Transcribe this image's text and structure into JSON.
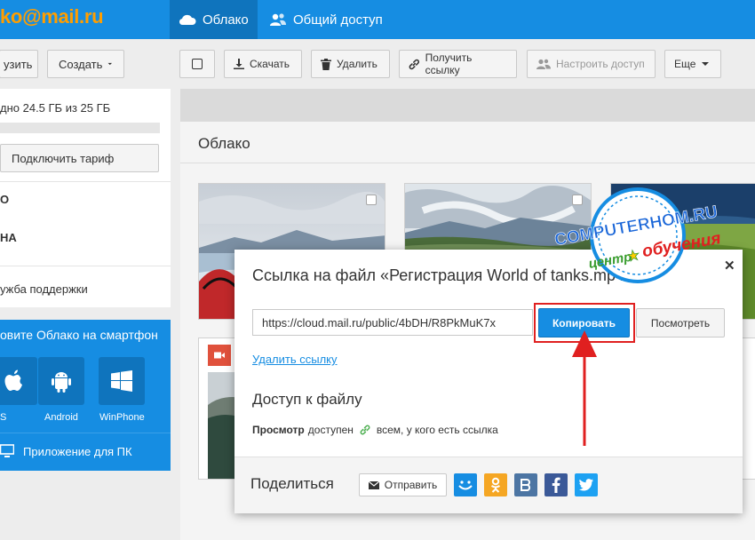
{
  "header": {
    "logo": "ko@mail.ru",
    "tabs": [
      {
        "label": "Облако",
        "icon": "cloud-icon",
        "active": true
      },
      {
        "label": "Общий доступ",
        "icon": "users-icon",
        "active": false
      }
    ]
  },
  "sidebar": {
    "upload_label": "узить",
    "create_label": "Создать",
    "storage_text": "дно 24.5 ГБ из 25 ГБ",
    "tariff_label": "Подключить тариф",
    "items": [
      {
        "label": "О",
        "bold": true
      },
      {
        "label": "НА",
        "bold": true
      },
      {
        "label": "ужба поддержки",
        "bold": false
      }
    ],
    "promo": {
      "title": "овите Облако на смартфон",
      "apps": [
        {
          "label": "S",
          "icon": "apple-icon"
        },
        {
          "label": "Android",
          "icon": "android-icon"
        },
        {
          "label": "WinPhone",
          "icon": "windows-icon"
        }
      ],
      "pc_app": "Приложение для ПК"
    }
  },
  "toolbar": {
    "download": "Скачать",
    "delete": "Удалить",
    "get_link": "Получить ссылку",
    "configure_access": "Настроить доступ",
    "more": "Еще"
  },
  "main": {
    "breadcrumb": "Облако"
  },
  "watermark": {
    "line1": "COMPUTERHOM.RU",
    "line2": "центр",
    "line3": "обучения"
  },
  "modal": {
    "title": "Ссылка на файл «Регистрация World of tanks.mp4",
    "link_value": "https://cloud.mail.ru/public/4bDH/R8PkMuK7x",
    "copy_label": "Копировать",
    "view_label": "Посмотреть",
    "delete_link": "Удалить ссылку",
    "access_title": "Доступ к файлу",
    "access_mode": "Просмотр",
    "access_available": "доступен",
    "access_who": "всем, у кого есть ссылка",
    "share_label": "Поделиться",
    "send_label": "Отправить",
    "social": [
      {
        "name": "mymail",
        "color": "#168de2"
      },
      {
        "name": "odnoklassniki",
        "color": "#f5a623"
      },
      {
        "name": "vkontakte",
        "color": "#4c75a3"
      },
      {
        "name": "facebook",
        "color": "#3b5998"
      },
      {
        "name": "twitter",
        "color": "#1da1f2"
      }
    ]
  },
  "colors": {
    "accent": "#168de2",
    "highlight": "#e02020"
  }
}
